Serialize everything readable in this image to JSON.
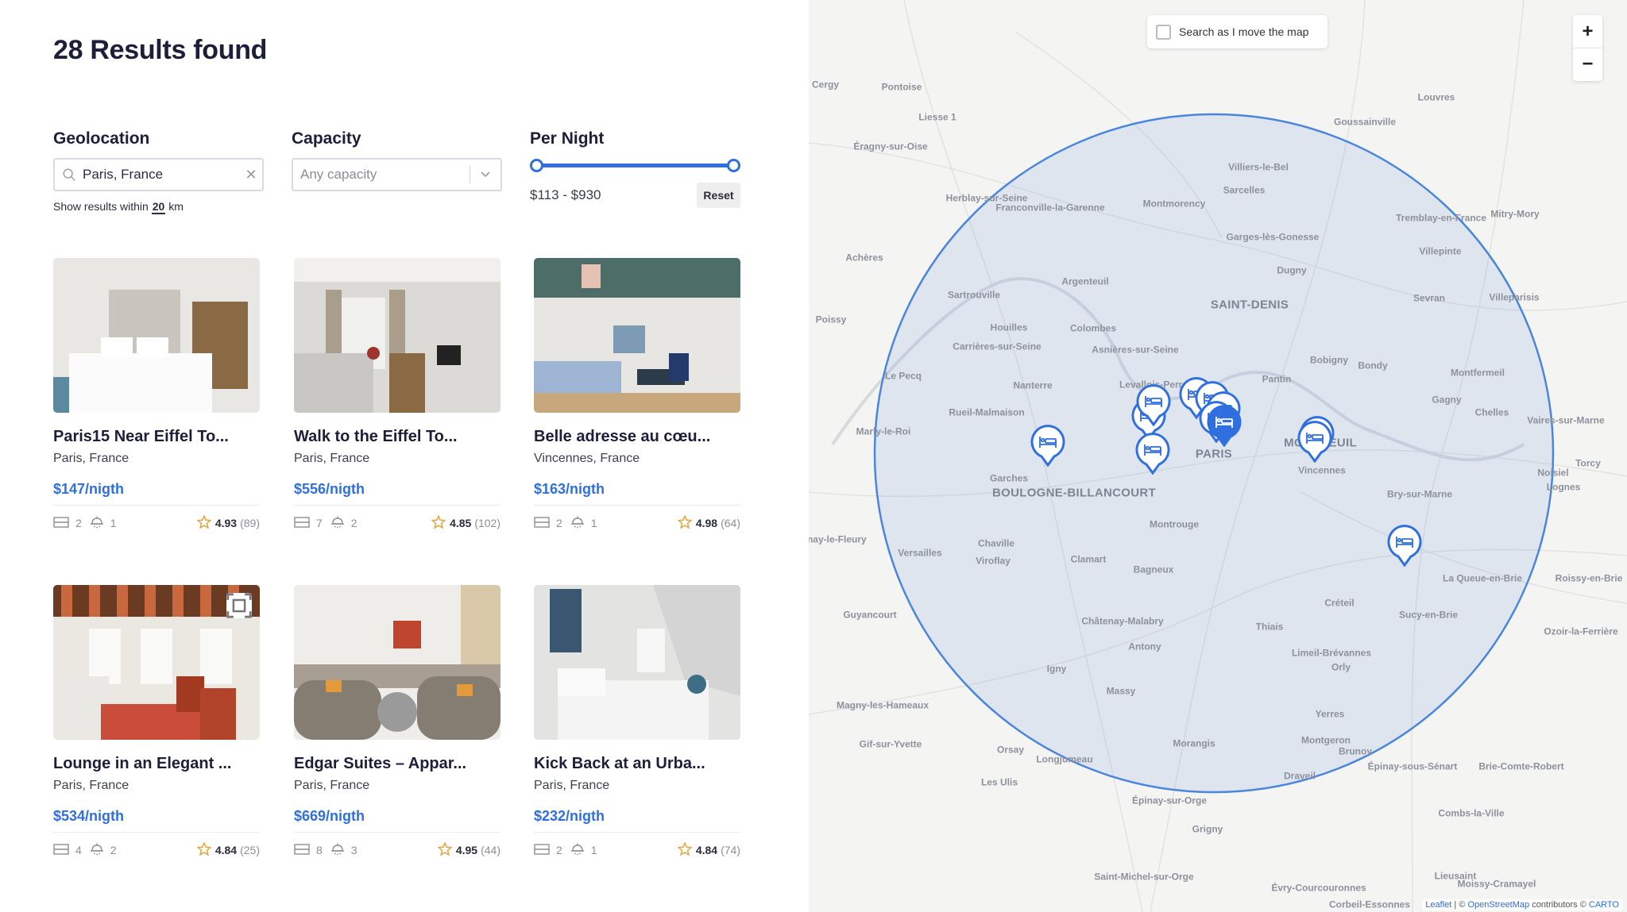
{
  "header": {
    "results_title": "28 Results found"
  },
  "filters": {
    "geolocation": {
      "label": "Geolocation",
      "value": "Paris, France",
      "radius_prefix": "Show results within",
      "radius_value": "20",
      "radius_unit": "km"
    },
    "capacity": {
      "label": "Capacity",
      "placeholder": "Any capacity"
    },
    "per_night": {
      "label": "Per Night",
      "range_text": "$113 - $930",
      "min_value": 113,
      "max_value": 930,
      "reset_label": "Reset"
    }
  },
  "listings": [
    {
      "title": "Paris15 Near Eiffel To...",
      "location": "Paris, France",
      "price": "$147/nigth",
      "beds": "2",
      "baths": "1",
      "rating": "4.93",
      "reviews": "(89)",
      "image": "white-bedroom"
    },
    {
      "title": "Walk to the Eiffel To...",
      "location": "Paris, France",
      "price": "$556/nigth",
      "beds": "7",
      "baths": "2",
      "rating": "4.85",
      "reviews": "(102)",
      "image": "grey-living-room"
    },
    {
      "title": "Belle adresse au cœu...",
      "location": "Vincennes, France",
      "price": "$163/nigth",
      "beds": "2",
      "baths": "1",
      "rating": "4.98",
      "reviews": "(64)",
      "image": "teal-ceiling-living-room"
    },
    {
      "title": "Lounge in an Elegant ...",
      "location": "Paris, France",
      "price": "$534/nigth",
      "beds": "4",
      "baths": "2",
      "rating": "4.84",
      "reviews": "(25)",
      "image": "beamed-ceiling-salon",
      "has_expand_icon": true
    },
    {
      "title": "Edgar Suites – Appar...",
      "location": "Paris, France",
      "price": "$669/nigth",
      "beds": "8",
      "baths": "3",
      "rating": "4.95",
      "reviews": "(44)",
      "image": "curved-sofas-lounge"
    },
    {
      "title": "Kick Back at an Urba...",
      "location": "Paris, France",
      "price": "$232/nigth",
      "beds": "2",
      "baths": "1",
      "rating": "4.84",
      "reviews": "(74)",
      "image": "attic-bedroom"
    }
  ],
  "map": {
    "search_as_move_label": "Search as I move the map",
    "search_as_move_checked": false,
    "zoom_in_label": "+",
    "zoom_out_label": "−",
    "attribution": {
      "leaflet": "Leaflet",
      "sep": " | © ",
      "osm": "OpenStreetMap",
      "contrib": " contributors © ",
      "carto": "CARTO"
    },
    "place_labels": [
      {
        "name": "Cergy"
      },
      {
        "name": "Pontoise"
      },
      {
        "name": "Liesse 1"
      },
      {
        "name": "Éragny-sur-Oise"
      },
      {
        "name": "Louvres"
      },
      {
        "name": "Goussainville"
      },
      {
        "name": "Villiers-le-Bel"
      },
      {
        "name": "Sarcelles"
      },
      {
        "name": "Montmorency"
      },
      {
        "name": "Herblay-sur-Seine"
      },
      {
        "name": "Franconville-la-Garenne"
      },
      {
        "name": "Garges-lès-Gonesse"
      },
      {
        "name": "Tremblay-en-France"
      },
      {
        "name": "Mitry-Mory"
      },
      {
        "name": "Villepinte"
      },
      {
        "name": "Achères"
      },
      {
        "name": "Dugny"
      },
      {
        "name": "Argenteuil"
      },
      {
        "name": "SAINT-DENIS",
        "big": true
      },
      {
        "name": "Sartrouville"
      },
      {
        "name": "Sevran"
      },
      {
        "name": "Villeparisis"
      },
      {
        "name": "Poissy"
      },
      {
        "name": "Houilles"
      },
      {
        "name": "Colombes"
      },
      {
        "name": "Carrières-sur-Seine"
      },
      {
        "name": "Asnières-sur-Seine"
      },
      {
        "name": "Bobigny"
      },
      {
        "name": "Bondy"
      },
      {
        "name": "Le Pecq"
      },
      {
        "name": "Nanterre"
      },
      {
        "name": "Levallois-Perret"
      },
      {
        "name": "Pantin"
      },
      {
        "name": "Montfermeil"
      },
      {
        "name": "Rueil-Malmaison"
      },
      {
        "name": "Gagny"
      },
      {
        "name": "Marly-le-Roi"
      },
      {
        "name": "Chelles"
      },
      {
        "name": "Vaires-sur-Marne"
      },
      {
        "name": "PARIS",
        "big": true
      },
      {
        "name": "MONTREUIL",
        "big": true
      },
      {
        "name": "Torcy"
      },
      {
        "name": "Garches"
      },
      {
        "name": "Vincennes"
      },
      {
        "name": "Noisiel"
      },
      {
        "name": "Lognes"
      },
      {
        "name": "BOULOGNE-BILLANCOURT",
        "big": true
      },
      {
        "name": "Bry-sur-Marne"
      },
      {
        "name": "Montrouge"
      },
      {
        "name": "Fontenay-le-Fleury"
      },
      {
        "name": "Chaville"
      },
      {
        "name": "Versailles"
      },
      {
        "name": "Viroflay"
      },
      {
        "name": "Clamart"
      },
      {
        "name": "Bagneux"
      },
      {
        "name": "La Queue-en-Brie"
      },
      {
        "name": "Roissy-en-Brie"
      },
      {
        "name": "Créteil"
      },
      {
        "name": "Guyancourt"
      },
      {
        "name": "Sucy-en-Brie"
      },
      {
        "name": "Châtenay-Malabry"
      },
      {
        "name": "Thiais"
      },
      {
        "name": "Ozoir-la-Ferrière"
      },
      {
        "name": "Antony"
      },
      {
        "name": "Limeil-Brévannes"
      },
      {
        "name": "Igny"
      },
      {
        "name": "Orly"
      },
      {
        "name": "Magny-les-Hameaux"
      },
      {
        "name": "Massy"
      },
      {
        "name": "Yerres"
      },
      {
        "name": "Gif-sur-Yvette"
      },
      {
        "name": "Orsay"
      },
      {
        "name": "Morangis"
      },
      {
        "name": "Montgeron"
      },
      {
        "name": "Brunoy"
      },
      {
        "name": "Longjumeau"
      },
      {
        "name": "Épinay-sous-Sénart"
      },
      {
        "name": "Brie-Comte-Robert"
      },
      {
        "name": "Les Ulis"
      },
      {
        "name": "Draveil"
      },
      {
        "name": "Épinay-sur-Orge"
      },
      {
        "name": "Combs-la-Ville"
      },
      {
        "name": "Grigny"
      },
      {
        "name": "Saint-Michel-sur-Orge"
      },
      {
        "name": "Évry-Courcouronnes"
      },
      {
        "name": "Lieusaint"
      },
      {
        "name": "Moissy-Cramayel"
      },
      {
        "name": "Corbeil-Essonnes"
      }
    ],
    "search_radius_km": 20,
    "marker_count_visible": 12,
    "active_marker_color": "#2f6fe0"
  },
  "colors": {
    "accent": "#2f6fe0",
    "title": "#1c1f3a",
    "star": "#e8a23a"
  }
}
